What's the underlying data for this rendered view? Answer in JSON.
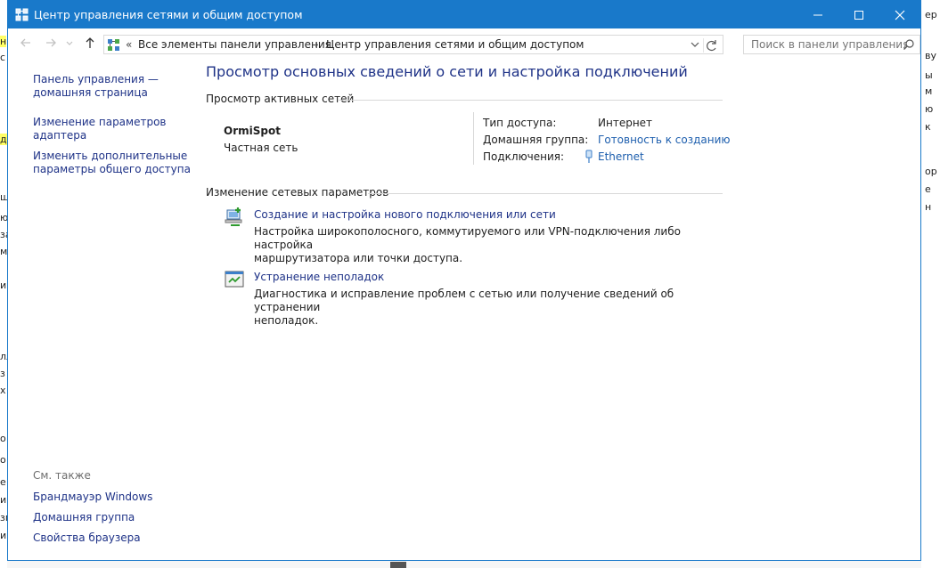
{
  "window": {
    "title": "Центр управления сетями и общим доступом",
    "accent": "#1979ca"
  },
  "addressbar": {
    "overflow": "«",
    "crumbs": [
      "Все элементы панели управления",
      "Центр управления сетями и общим доступом"
    ],
    "separator": "›",
    "search_placeholder": "Поиск в панели управления"
  },
  "sidebar": {
    "links": [
      {
        "lines": [
          "Панель управления —",
          "домашняя страница"
        ]
      },
      {
        "lines": [
          "Изменение параметров",
          "адаптера"
        ]
      },
      {
        "lines": [
          "Изменить дополнительные",
          "параметры общего доступа"
        ]
      }
    ],
    "see_also_label": "См. также",
    "see_also": [
      "Брандмауэр Windows",
      "Домашняя группа",
      "Свойства браузера"
    ]
  },
  "main": {
    "title": "Просмотр основных сведений о сети и настройка подключений",
    "active_networks_header": "Просмотр активных сетей",
    "network": {
      "name": "OrmiSpot",
      "type": "Частная сеть",
      "access_type_label": "Тип доступа:",
      "access_type_value": "Интернет",
      "homegroup_label": "Домашняя группа:",
      "homegroup_value": "Готовность к созданию",
      "connections_label": "Подключения:",
      "connections_value": "Ethernet"
    },
    "change_settings_header": "Изменение сетевых параметров",
    "tasks": [
      {
        "icon": "network-setup-icon",
        "title": "Создание и настройка нового подключения или сети",
        "desc": [
          "Настройка широкополосного, коммутируемого или VPN-подключения либо настройка",
          "маршрутизатора или точки доступа."
        ]
      },
      {
        "icon": "troubleshoot-icon",
        "title": "Устранение неполадок",
        "desc": [
          "Диагностика и исправление проблем с сетью или получение сведений об устранении",
          "неполадок."
        ]
      }
    ]
  },
  "background": {
    "left_fragments": [
      "н",
      "с",
      "д",
      "ш",
      "ю",
      "за",
      "м",
      "и",
      "",
      "лл",
      "з",
      "х",
      "о",
      "о",
      "е",
      "и",
      "зм",
      "и"
    ],
    "right_fragments": [
      "ер",
      "ву",
      "ы",
      "м",
      "ю",
      "к",
      "ю",
      "ор",
      "е",
      "н"
    ]
  }
}
